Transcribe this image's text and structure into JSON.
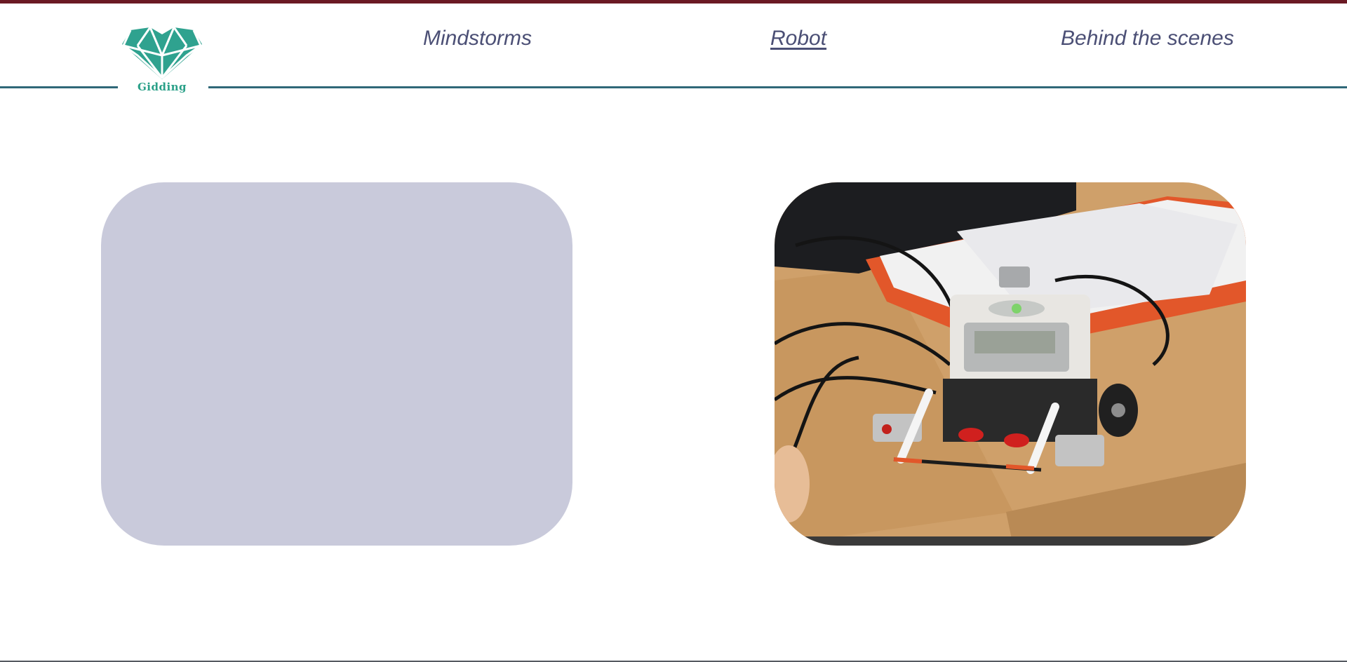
{
  "nav": {
    "items": [
      {
        "label": "Mindstorms",
        "active": false
      },
      {
        "label": "Robot",
        "active": true
      },
      {
        "label": "Behind the scenes",
        "active": false
      }
    ]
  },
  "logo": {
    "text": "Gidding",
    "color": "#2aa088"
  },
  "colors": {
    "top_strip": "#6b1a24",
    "header_line": "#2f6878",
    "nav_text": "#4b4f75",
    "placeholder_panel": "#c9cadb"
  },
  "main": {
    "left_panel": {
      "icon": "placeholder-block"
    },
    "right_panel": {
      "icon": "lego-mindstorms-robot-photo"
    }
  }
}
